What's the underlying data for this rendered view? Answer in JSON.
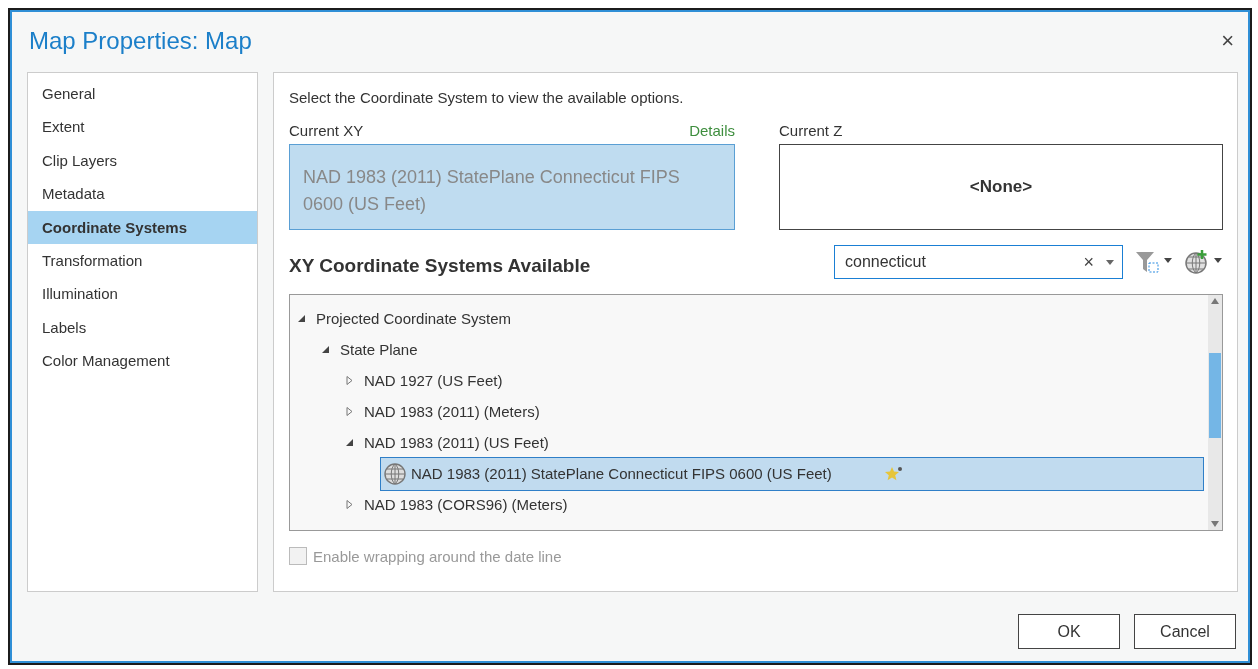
{
  "window": {
    "title": "Map Properties: Map",
    "close": "×"
  },
  "sidebar": {
    "items": [
      {
        "label": "General",
        "selected": false
      },
      {
        "label": "Extent",
        "selected": false
      },
      {
        "label": "Clip Layers",
        "selected": false
      },
      {
        "label": "Metadata",
        "selected": false
      },
      {
        "label": "Coordinate Systems",
        "selected": true
      },
      {
        "label": "Transformation",
        "selected": false
      },
      {
        "label": "Illumination",
        "selected": false
      },
      {
        "label": "Labels",
        "selected": false
      },
      {
        "label": "Color Management",
        "selected": false
      }
    ]
  },
  "instruction": "Select the Coordinate System to view the available options.",
  "current_xy": {
    "label": "Current XY",
    "link": "Details",
    "value": "NAD 1983 (2011) StatePlane Connecticut FIPS 0600 (US Feet)"
  },
  "current_z": {
    "label": "Current Z",
    "value": "<None>"
  },
  "available": {
    "heading": "XY Coordinate Systems Available",
    "search": {
      "value": "connecticut",
      "clear": "×"
    }
  },
  "tree": [
    {
      "kind": "group",
      "label": "Projected Coordinate System",
      "expanded": true,
      "children": [
        {
          "kind": "group",
          "label": "State Plane",
          "expanded": true,
          "children": [
            {
              "kind": "group",
              "label": "NAD 1927 (US Feet)",
              "expanded": false
            },
            {
              "kind": "group",
              "label": "NAD 1983 (2011) (Meters)",
              "expanded": false
            },
            {
              "kind": "group",
              "label": "NAD 1983 (2011) (US Feet)",
              "expanded": true,
              "children": [
                {
                  "kind": "system",
                  "label": "NAD 1983 (2011) StatePlane Connecticut FIPS 0600 (US Feet)",
                  "selected": true,
                  "favorite": true
                }
              ]
            },
            {
              "kind": "group",
              "label": "NAD 1983 (CORS96) (Meters)",
              "expanded": false
            }
          ]
        }
      ]
    }
  ],
  "wrap_option": {
    "label": "Enable wrapping around the date line",
    "checked": false,
    "disabled": true
  },
  "buttons": [
    "OK",
    "Cancel"
  ]
}
